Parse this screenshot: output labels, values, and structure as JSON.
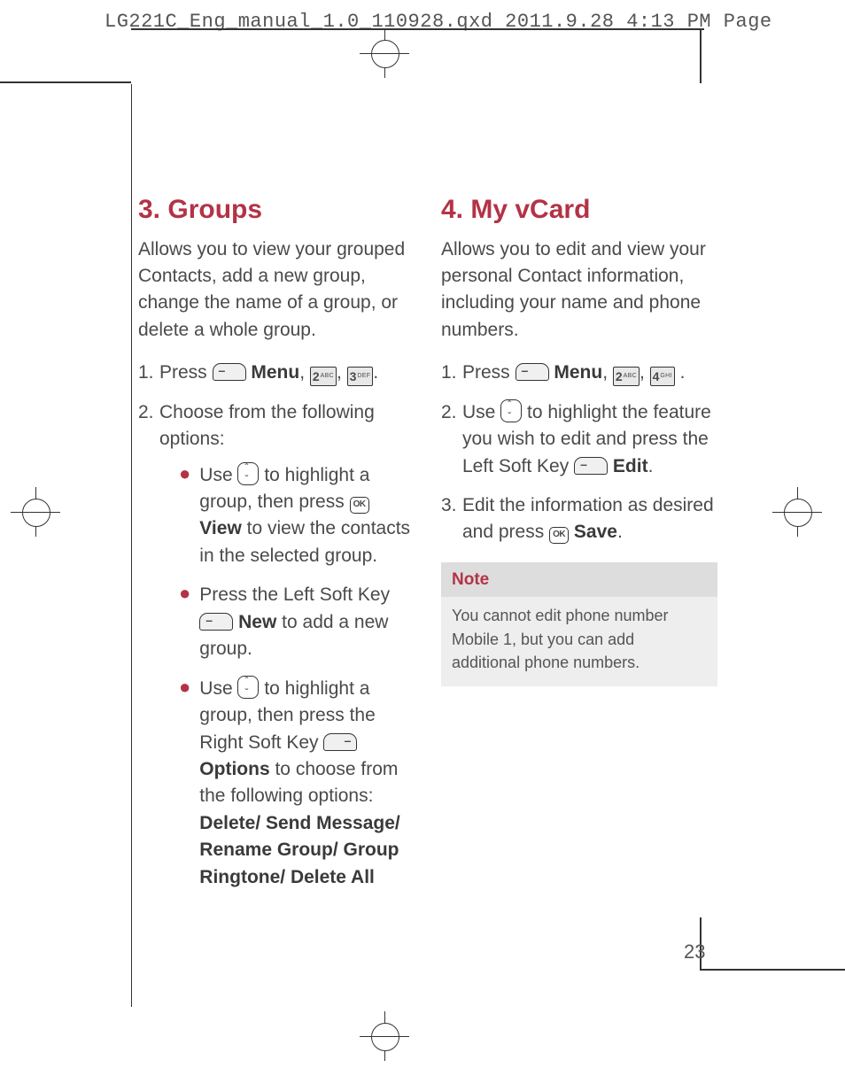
{
  "header": "LG221C_Eng_manual_1.0_110928.qxd  2011.9.28  4:13 PM  Page",
  "page_number": "23",
  "col1": {
    "heading": "3. Groups",
    "intro": "Allows you to view your grouped Contacts, add a new group, change the name of a group, or delete a whole group.",
    "step1_num": "1.",
    "step1_a": "Press ",
    "step1_menu": "Menu",
    "step1_b": ", ",
    "step1_c": ", ",
    "step1_d": ".",
    "step2_num": "2.",
    "step2": "Choose from the following options:",
    "b1a": "Use ",
    "b1b": " to highlight a group, then press ",
    "b1_view": "View",
    "b1c": " to view the contacts in the selected group.",
    "b2a": "Press the Left Soft Key ",
    "b2_new": "New",
    "b2b": " to add a new group.",
    "b3a": "Use ",
    "b3b": " to highlight a group, then press the Right Soft Key ",
    "b3_opt": "Options",
    "b3c": " to choose from the following options: ",
    "b3_opts": "Delete/ Send Message/ Rename Group/ Group Ringtone/ Delete All"
  },
  "col2": {
    "heading": "4. My vCard",
    "intro": "Allows you to edit and view your personal Contact information, including your name and phone numbers.",
    "step1_num": "1.",
    "step1_a": "Press ",
    "step1_menu": "Menu",
    "step1_b": ", ",
    "step1_c": ", ",
    "step1_d": " .",
    "step2_num": "2.",
    "step2a": "Use ",
    "step2b": " to highlight the feature you wish to edit and press the Left Soft Key ",
    "step2_edit": "Edit",
    "step2c": ".",
    "step3_num": "3.",
    "step3a": "Edit the information as desired and press ",
    "step3_save": "Save",
    "step3b": ".",
    "note_head": "Note",
    "note_body": "You cannot edit phone number Mobile 1, but you can add additional phone numbers."
  },
  "keys": {
    "k2": {
      "n": "2",
      "s": "ABC"
    },
    "k3": {
      "n": "3",
      "s": "DEF"
    },
    "k4": {
      "n": "4",
      "s": "GHI"
    },
    "ok": "OK"
  }
}
